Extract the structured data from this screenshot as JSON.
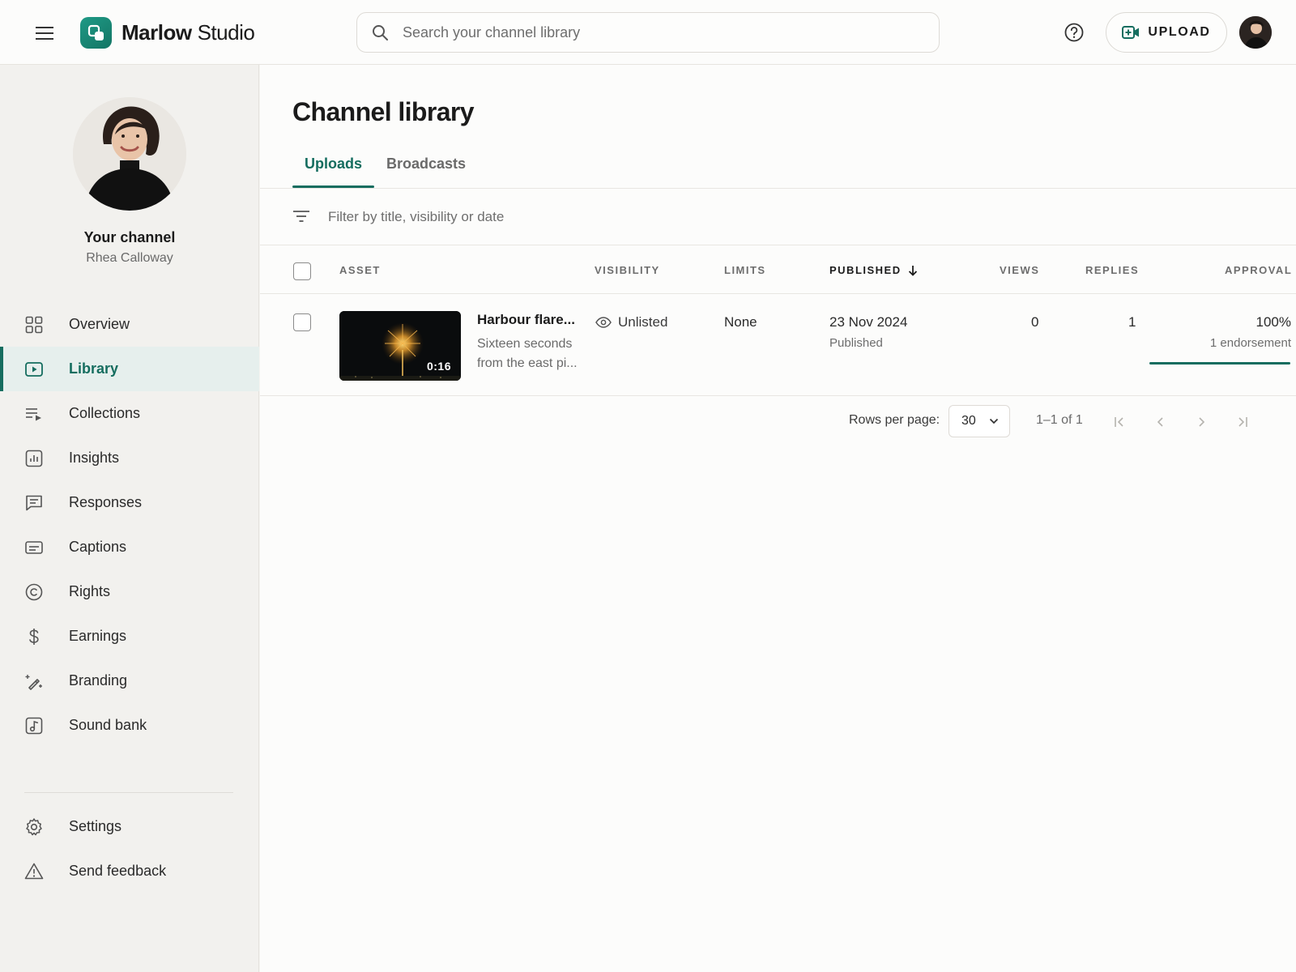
{
  "app": {
    "brand_bold": "Marlow",
    "brand_light": "Studio"
  },
  "header": {
    "search_placeholder": "Search your channel library",
    "upload_label": "UPLOAD"
  },
  "channel": {
    "title": "Your channel",
    "name": "Rhea Calloway"
  },
  "sidebar": {
    "items": [
      {
        "label": "Overview",
        "icon": "grid-icon"
      },
      {
        "label": "Library",
        "icon": "play-box-icon",
        "active": true
      },
      {
        "label": "Collections",
        "icon": "playlist-icon"
      },
      {
        "label": "Insights",
        "icon": "bar-chart-icon"
      },
      {
        "label": "Responses",
        "icon": "comment-icon"
      },
      {
        "label": "Captions",
        "icon": "subtitles-icon"
      },
      {
        "label": "Rights",
        "icon": "copyright-icon"
      },
      {
        "label": "Earnings",
        "icon": "dollar-icon"
      },
      {
        "label": "Branding",
        "icon": "magic-wand-icon"
      },
      {
        "label": "Sound bank",
        "icon": "music-note-icon"
      }
    ],
    "footer_items": [
      {
        "label": "Settings",
        "icon": "gear-icon"
      },
      {
        "label": "Send feedback",
        "icon": "warning-icon"
      }
    ]
  },
  "main": {
    "title": "Channel library",
    "tabs": [
      {
        "label": "Uploads",
        "active": true
      },
      {
        "label": "Broadcasts",
        "active": false
      }
    ],
    "filter_placeholder": "Filter by title, visibility or date",
    "columns": {
      "asset": "ASSET",
      "visibility": "VISIBILITY",
      "limits": "LIMITS",
      "published": "PUBLISHED",
      "views": "VIEWS",
      "replies": "REPLIES",
      "approval": "APPROVAL"
    },
    "rows": [
      {
        "duration": "0:16",
        "title": "Harbour flare...",
        "description": "Sixteen seconds from the east pi...",
        "visibility": "Unlisted",
        "limits": "None",
        "published_date": "23 Nov 2024",
        "published_status": "Published",
        "views": "0",
        "replies": "1",
        "approval_percent": "100%",
        "approval_count": "1 endorsement",
        "approval_fraction": 1.0
      }
    ],
    "pagination": {
      "rows_per_page_label": "Rows per page:",
      "rows_per_page_value": "30",
      "range": "1–1 of 1"
    }
  },
  "colors": {
    "accent": "#156d5f",
    "brand_logo": "#1a8a77"
  }
}
